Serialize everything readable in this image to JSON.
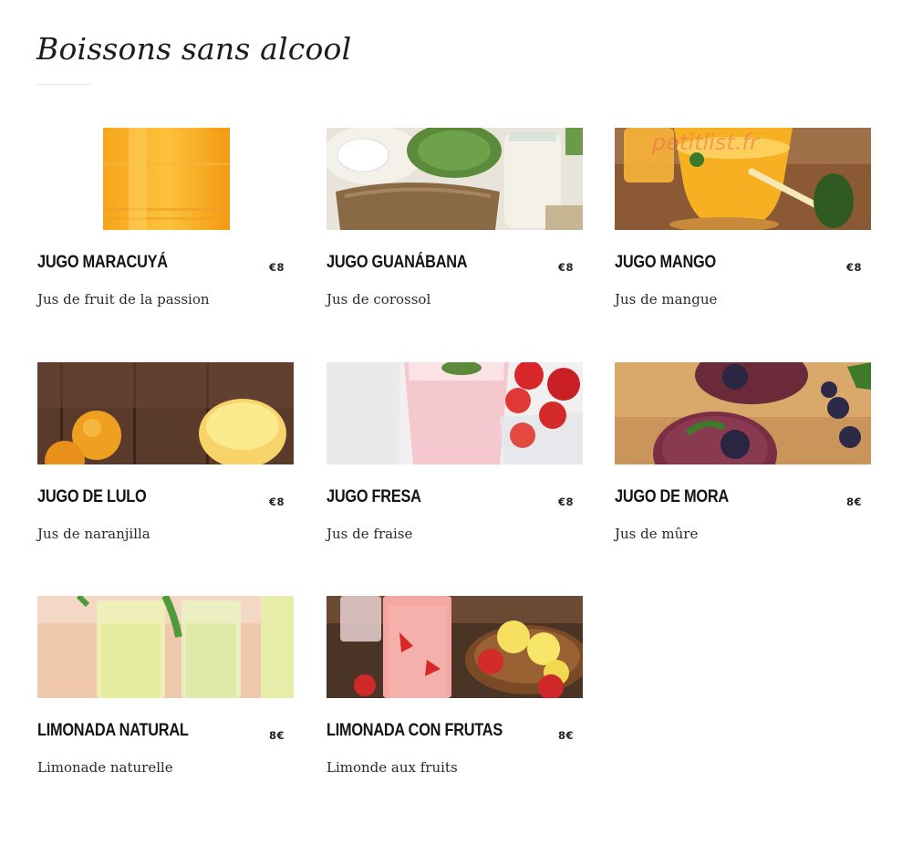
{
  "page": {
    "title": "Boissons sans alcool"
  },
  "watermark": "petitlist.fr",
  "items": [
    {
      "name": "JUGO MARACUYÁ",
      "price": "€8",
      "description": "Jus de fruit de la passion"
    },
    {
      "name": "JUGO GUANÁBANA",
      "price": "€8",
      "description": "Jus de corossol"
    },
    {
      "name": "JUGO MANGO",
      "price": "€8",
      "description": "Jus de mangue"
    },
    {
      "name": "JUGO DE LULO",
      "price": "€8",
      "description": "Jus de naranjilla"
    },
    {
      "name": "JUGO FRESA",
      "price": "€8",
      "description": "Jus de fraise"
    },
    {
      "name": "JUGO DE MORA",
      "price": "8€",
      "description": "Jus de mûre"
    },
    {
      "name": "LIMONADA NATURAL",
      "price": "8€",
      "description": "Limonade naturelle"
    },
    {
      "name": "LIMONADA CON FRUTAS",
      "price": "8€",
      "description": "Limonde aux fruits"
    }
  ]
}
